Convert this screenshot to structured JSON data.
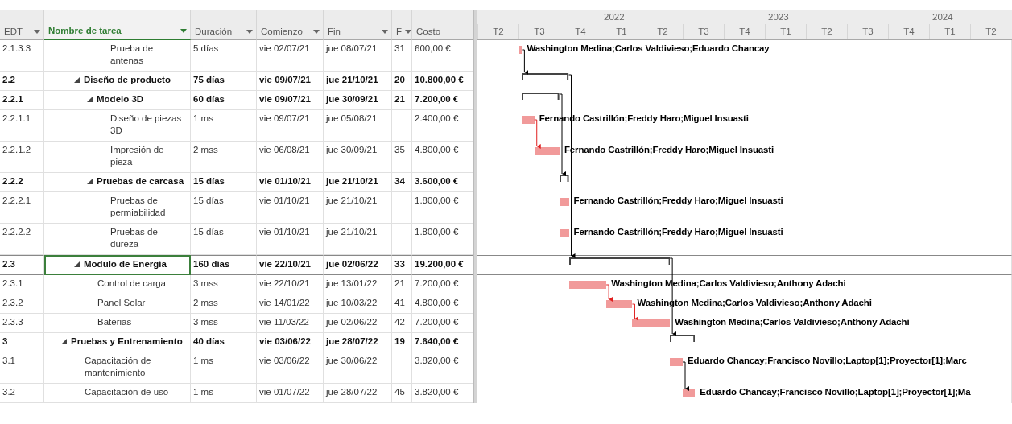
{
  "columns": [
    {
      "label": "EDT",
      "selected": false,
      "menu": true
    },
    {
      "label": "Nombre de tarea",
      "selected": true,
      "menu": true
    },
    {
      "label": "Duración",
      "selected": false,
      "menu": true
    },
    {
      "label": "Comienzo",
      "selected": false,
      "menu": true
    },
    {
      "label": "Fin",
      "selected": false,
      "menu": true
    },
    {
      "label": "F",
      "selected": false,
      "menu": true
    },
    {
      "label": "Costo",
      "selected": false,
      "menu": false
    }
  ],
  "timescale": [
    {
      "quarters": [
        "T2",
        "T3",
        "T4"
      ]
    },
    {
      "year": "2022",
      "quarters": [
        "T1",
        "T2",
        "T3",
        "T4"
      ]
    },
    {
      "year": "2023",
      "quarters": [
        "T1",
        "T2",
        "T3",
        "T4"
      ]
    },
    {
      "year": "2024",
      "quarters": [
        "T1",
        "T2"
      ]
    }
  ],
  "rows": [
    {
      "edt": "2.1.3.3",
      "name": "Prueba de antenas",
      "duration": "5 días",
      "start": "vie 02/07/21",
      "finish": "jue 08/07/21",
      "pred": "31",
      "cost": "600,00 €",
      "selected": false,
      "resources": "Washington Medina;Carlos Valdivieso;Eduardo Chancay"
    },
    {
      "edt": "2.2",
      "name": "Diseño de producto",
      "duration": "75 días",
      "start": "vie 09/07/21",
      "finish": "jue 21/10/21",
      "pred": "20",
      "cost": "10.800,00 €",
      "selected": false,
      "link": {
        "critical": false
      },
      "expanded": true,
      "children": [
        {
          "edt": "2.2.1",
          "name": "Modelo 3D",
          "duration": "60 días",
          "start": "vie 09/07/21",
          "finish": "jue 30/09/21",
          "pred": "21",
          "cost": "7.200,00 €",
          "selected": false,
          "expanded": true,
          "children": [
            {
              "edt": "2.2.1.1",
              "name": "Diseño de piezas 3D",
              "duration": "1 ms",
              "start": "vie 09/07/21",
              "finish": "jue 05/08/21",
              "cost": "2.400,00 €",
              "selected": false,
              "resources": "Fernando Castrillón;Freddy Haro;Miguel Insuasti"
            },
            {
              "edt": "2.2.1.2",
              "name": "Impresión de pieza",
              "duration": "2 mss",
              "start": "vie 06/08/21",
              "finish": "jue 30/09/21",
              "pred": "35",
              "cost": "4.800,00 €",
              "selected": false,
              "link": {
                "critical": true
              },
              "resources": "Fernando Castrillón;Freddy Haro;Miguel Insuasti"
            }
          ]
        },
        {
          "edt": "2.2.2",
          "name": "Pruebas de carcasa",
          "duration": "15 días",
          "start": "vie 01/10/21",
          "finish": "jue 21/10/21",
          "pred": "34",
          "cost": "3.600,00 €",
          "selected": false,
          "link": {
            "critical": false
          },
          "expanded": true,
          "children": [
            {
              "edt": "2.2.2.1",
              "name": "Pruebas de permiabilidad",
              "duration": "15 días",
              "start": "vie 01/10/21",
              "finish": "jue 21/10/21",
              "cost": "1.800,00 €",
              "selected": false,
              "resources": "Fernando Castrillón;Freddy Haro;Miguel Insuasti"
            },
            {
              "edt": "2.2.2.2",
              "name": "Pruebas de dureza",
              "duration": "15 días",
              "start": "vie 01/10/21",
              "finish": "jue 21/10/21",
              "cost": "1.800,00 €",
              "selected": false,
              "resources": "Fernando Castrillón;Freddy Haro;Miguel Insuasti"
            }
          ]
        }
      ]
    },
    {
      "edt": "2.3",
      "name": "Modulo de Energía",
      "duration": "160 días",
      "start": "vie 22/10/21",
      "finish": "jue 02/06/22",
      "pred": "33",
      "cost": "19.200,00 €",
      "selected": true,
      "link": {
        "critical": false
      },
      "expanded": true,
      "children": [
        {
          "edt": "2.3.1",
          "name": "Control de carga",
          "duration": "3 mss",
          "start": "vie 22/10/21",
          "finish": "jue 13/01/22",
          "pred": "21",
          "cost": "7.200,00 €",
          "selected": false,
          "resources": "Washington Medina;Carlos Valdivieso;Anthony Adachi"
        },
        {
          "edt": "2.3.2",
          "name": "Panel Solar",
          "duration": "2 mss",
          "start": "vie 14/01/22",
          "finish": "jue 10/03/22",
          "pred": "41",
          "cost": "4.800,00 €",
          "selected": false,
          "link": {
            "critical": true
          },
          "resources": "Washington Medina;Carlos Valdivieso;Anthony Adachi"
        },
        {
          "edt": "2.3.3",
          "name": "Baterias",
          "duration": "3 mss",
          "start": "vie 11/03/22",
          "finish": "jue 02/06/22",
          "pred": "42",
          "cost": "7.200,00 €",
          "selected": false,
          "link": {
            "critical": true
          },
          "resources": "Washington Medina;Carlos Valdivieso;Anthony Adachi"
        }
      ]
    },
    {
      "edt": "3",
      "name": "Pruebas y Entrenamiento",
      "duration": "40 días",
      "start": "vie 03/06/22",
      "finish": "jue 28/07/22",
      "pred": "19",
      "cost": "7.640,00 €",
      "selected": false,
      "link": {
        "critical": false
      },
      "expanded": true,
      "children": [
        {
          "edt": "3.1",
          "name": "Capacitación de mantenimiento",
          "duration": "1 ms",
          "start": "vie 03/06/22",
          "finish": "jue 30/06/22",
          "cost": "3.820,00 €",
          "selected": false,
          "resources": "Eduardo Chancay;Francisco Novillo;Laptop[1];Proyector[1];Marc"
        },
        {
          "edt": "3.2",
          "name": "Capacitación de uso",
          "duration": "1 ms",
          "start": "vie 01/07/22",
          "finish": "jue 28/07/22",
          "pred": "45",
          "cost": "3.820,00 €",
          "selected": false,
          "link": {
            "critical": false
          },
          "resources": "Eduardo Chancay;Francisco Novillo;Laptop[1];Proyector[1];Ma"
        }
      ]
    }
  ]
}
